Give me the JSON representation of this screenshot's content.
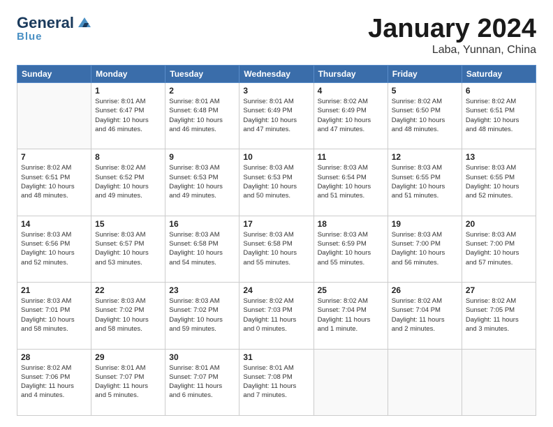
{
  "header": {
    "logo_general": "General",
    "logo_blue": "Blue",
    "title": "January 2024",
    "location": "Laba, Yunnan, China"
  },
  "weekdays": [
    "Sunday",
    "Monday",
    "Tuesday",
    "Wednesday",
    "Thursday",
    "Friday",
    "Saturday"
  ],
  "weeks": [
    [
      {
        "day": "",
        "info": ""
      },
      {
        "day": "1",
        "info": "Sunrise: 8:01 AM\nSunset: 6:47 PM\nDaylight: 10 hours\nand 46 minutes."
      },
      {
        "day": "2",
        "info": "Sunrise: 8:01 AM\nSunset: 6:48 PM\nDaylight: 10 hours\nand 46 minutes."
      },
      {
        "day": "3",
        "info": "Sunrise: 8:01 AM\nSunset: 6:49 PM\nDaylight: 10 hours\nand 47 minutes."
      },
      {
        "day": "4",
        "info": "Sunrise: 8:02 AM\nSunset: 6:49 PM\nDaylight: 10 hours\nand 47 minutes."
      },
      {
        "day": "5",
        "info": "Sunrise: 8:02 AM\nSunset: 6:50 PM\nDaylight: 10 hours\nand 48 minutes."
      },
      {
        "day": "6",
        "info": "Sunrise: 8:02 AM\nSunset: 6:51 PM\nDaylight: 10 hours\nand 48 minutes."
      }
    ],
    [
      {
        "day": "7",
        "info": "Sunrise: 8:02 AM\nSunset: 6:51 PM\nDaylight: 10 hours\nand 48 minutes."
      },
      {
        "day": "8",
        "info": "Sunrise: 8:02 AM\nSunset: 6:52 PM\nDaylight: 10 hours\nand 49 minutes."
      },
      {
        "day": "9",
        "info": "Sunrise: 8:03 AM\nSunset: 6:53 PM\nDaylight: 10 hours\nand 49 minutes."
      },
      {
        "day": "10",
        "info": "Sunrise: 8:03 AM\nSunset: 6:53 PM\nDaylight: 10 hours\nand 50 minutes."
      },
      {
        "day": "11",
        "info": "Sunrise: 8:03 AM\nSunset: 6:54 PM\nDaylight: 10 hours\nand 51 minutes."
      },
      {
        "day": "12",
        "info": "Sunrise: 8:03 AM\nSunset: 6:55 PM\nDaylight: 10 hours\nand 51 minutes."
      },
      {
        "day": "13",
        "info": "Sunrise: 8:03 AM\nSunset: 6:55 PM\nDaylight: 10 hours\nand 52 minutes."
      }
    ],
    [
      {
        "day": "14",
        "info": "Sunrise: 8:03 AM\nSunset: 6:56 PM\nDaylight: 10 hours\nand 52 minutes."
      },
      {
        "day": "15",
        "info": "Sunrise: 8:03 AM\nSunset: 6:57 PM\nDaylight: 10 hours\nand 53 minutes."
      },
      {
        "day": "16",
        "info": "Sunrise: 8:03 AM\nSunset: 6:58 PM\nDaylight: 10 hours\nand 54 minutes."
      },
      {
        "day": "17",
        "info": "Sunrise: 8:03 AM\nSunset: 6:58 PM\nDaylight: 10 hours\nand 55 minutes."
      },
      {
        "day": "18",
        "info": "Sunrise: 8:03 AM\nSunset: 6:59 PM\nDaylight: 10 hours\nand 55 minutes."
      },
      {
        "day": "19",
        "info": "Sunrise: 8:03 AM\nSunset: 7:00 PM\nDaylight: 10 hours\nand 56 minutes."
      },
      {
        "day": "20",
        "info": "Sunrise: 8:03 AM\nSunset: 7:00 PM\nDaylight: 10 hours\nand 57 minutes."
      }
    ],
    [
      {
        "day": "21",
        "info": "Sunrise: 8:03 AM\nSunset: 7:01 PM\nDaylight: 10 hours\nand 58 minutes."
      },
      {
        "day": "22",
        "info": "Sunrise: 8:03 AM\nSunset: 7:02 PM\nDaylight: 10 hours\nand 58 minutes."
      },
      {
        "day": "23",
        "info": "Sunrise: 8:03 AM\nSunset: 7:02 PM\nDaylight: 10 hours\nand 59 minutes."
      },
      {
        "day": "24",
        "info": "Sunrise: 8:02 AM\nSunset: 7:03 PM\nDaylight: 11 hours\nand 0 minutes."
      },
      {
        "day": "25",
        "info": "Sunrise: 8:02 AM\nSunset: 7:04 PM\nDaylight: 11 hours\nand 1 minute."
      },
      {
        "day": "26",
        "info": "Sunrise: 8:02 AM\nSunset: 7:04 PM\nDaylight: 11 hours\nand 2 minutes."
      },
      {
        "day": "27",
        "info": "Sunrise: 8:02 AM\nSunset: 7:05 PM\nDaylight: 11 hours\nand 3 minutes."
      }
    ],
    [
      {
        "day": "28",
        "info": "Sunrise: 8:02 AM\nSunset: 7:06 PM\nDaylight: 11 hours\nand 4 minutes."
      },
      {
        "day": "29",
        "info": "Sunrise: 8:01 AM\nSunset: 7:07 PM\nDaylight: 11 hours\nand 5 minutes."
      },
      {
        "day": "30",
        "info": "Sunrise: 8:01 AM\nSunset: 7:07 PM\nDaylight: 11 hours\nand 6 minutes."
      },
      {
        "day": "31",
        "info": "Sunrise: 8:01 AM\nSunset: 7:08 PM\nDaylight: 11 hours\nand 7 minutes."
      },
      {
        "day": "",
        "info": ""
      },
      {
        "day": "",
        "info": ""
      },
      {
        "day": "",
        "info": ""
      }
    ]
  ]
}
